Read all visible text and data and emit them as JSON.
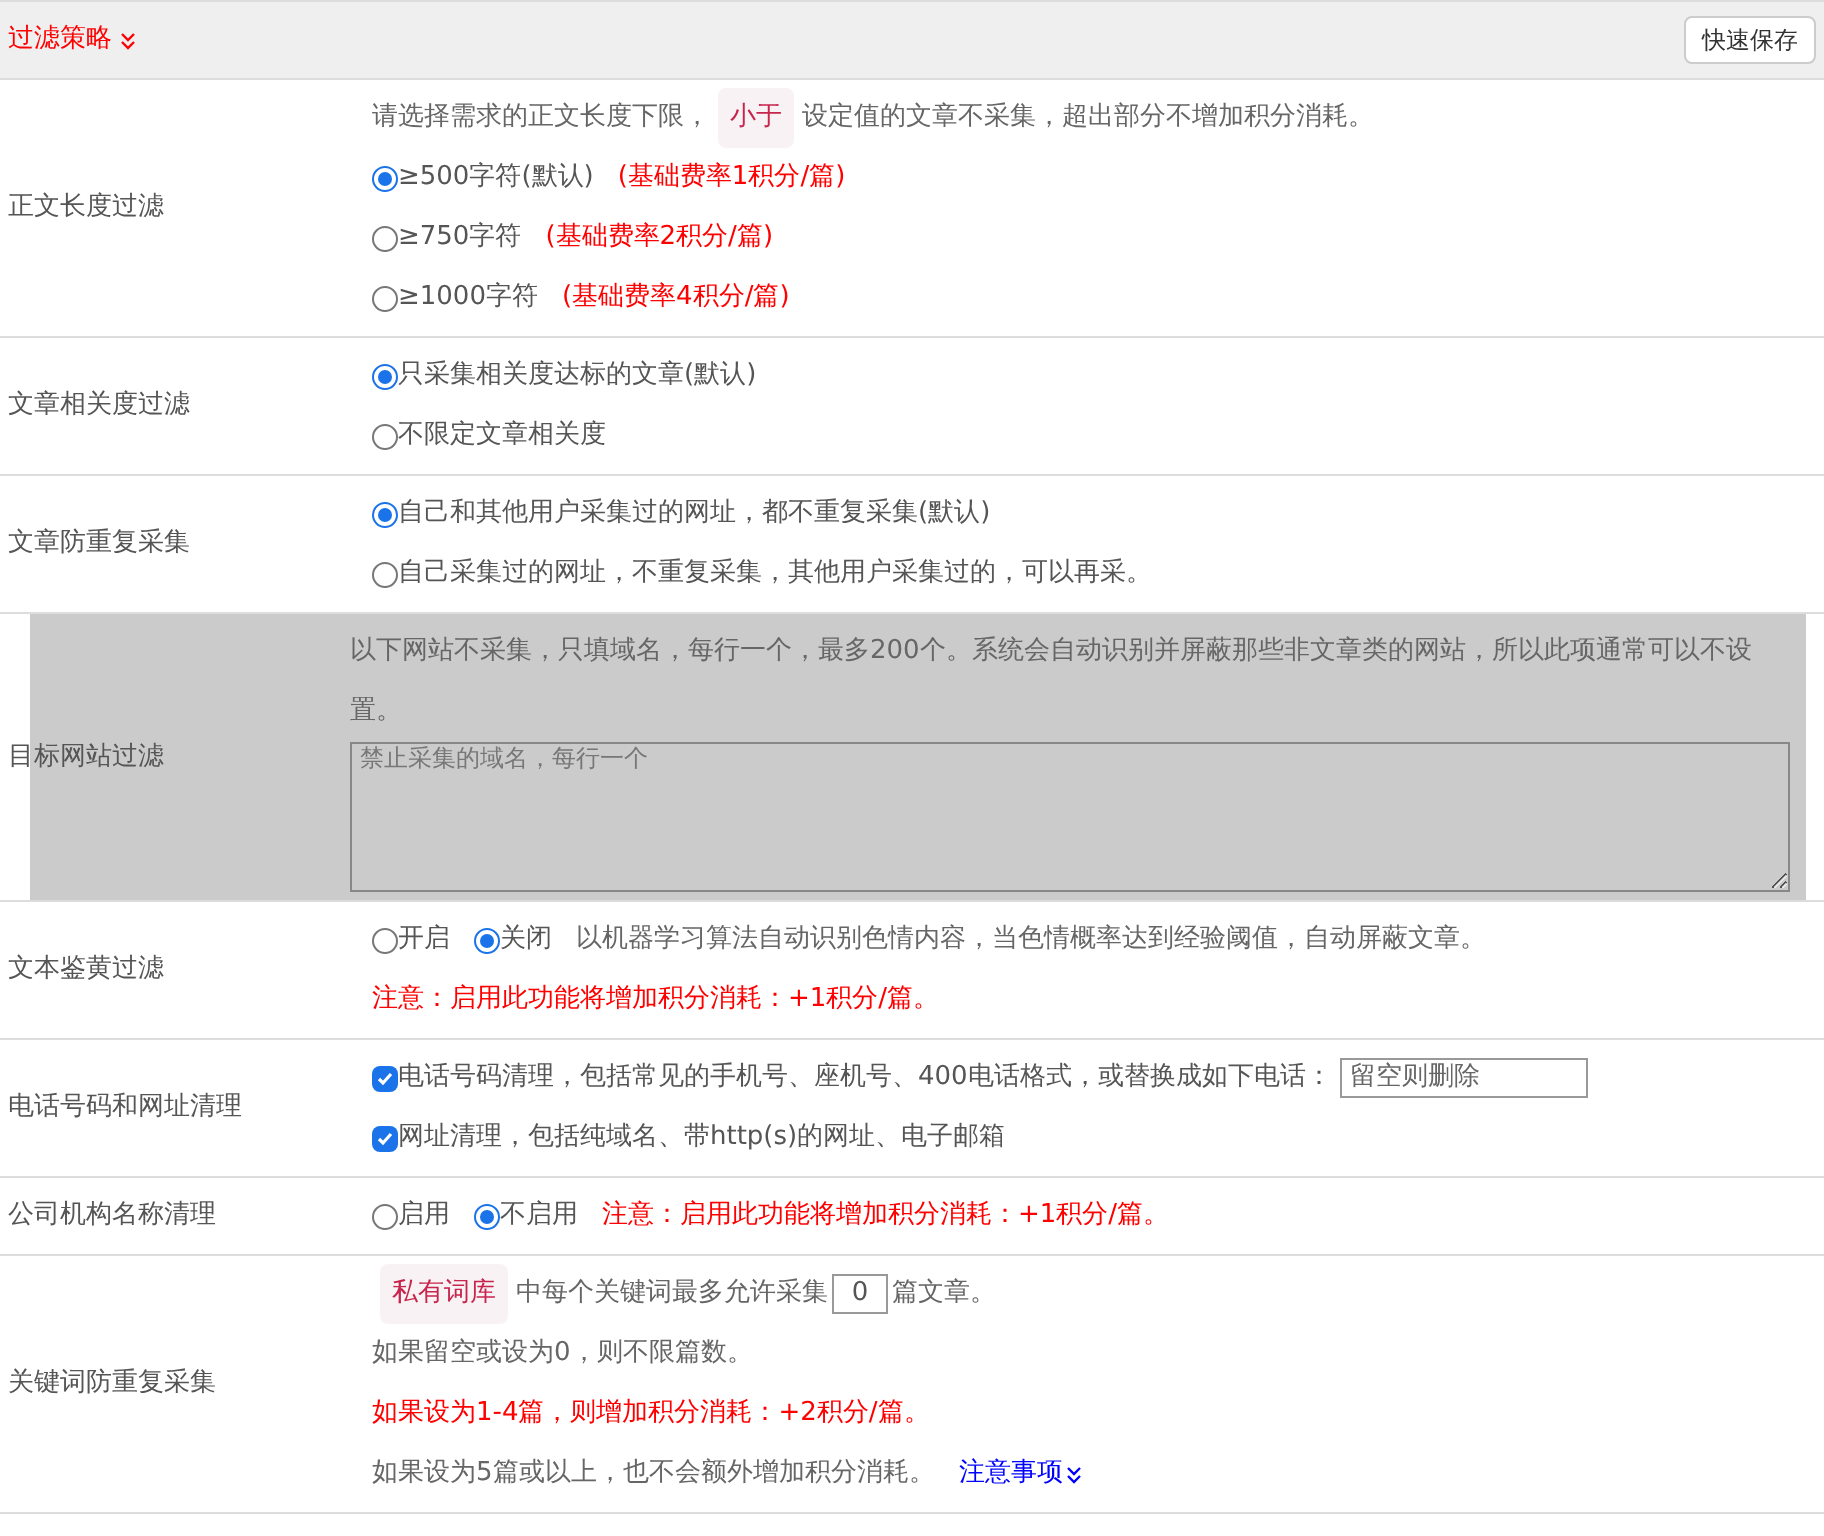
{
  "header": {
    "title": "过滤策略",
    "save_button": "快速保存"
  },
  "rows": [
    {
      "label": "正文长度过滤",
      "shaded": false,
      "lines": [
        [
          {
            "kind": "text",
            "text": "请选择需求的正文长度下限，"
          },
          {
            "kind": "tag",
            "text": "小于"
          },
          {
            "kind": "text",
            "text": "设定值的文章不采集，超出部分不增加积分消耗。"
          }
        ],
        [
          {
            "kind": "radio",
            "text": "≥500字符(默认)",
            "selected": true
          },
          {
            "kind": "note",
            "text": "(基础费率1积分/篇)"
          }
        ],
        [
          {
            "kind": "radio",
            "text": "≥750字符",
            "selected": false
          },
          {
            "kind": "note",
            "text": "(基础费率2积分/篇)"
          }
        ],
        [
          {
            "kind": "radio",
            "text": "≥1000字符",
            "selected": false
          },
          {
            "kind": "note",
            "text": "(基础费率4积分/篇)"
          }
        ]
      ]
    },
    {
      "label": "文章相关度过滤",
      "shaded": false,
      "lines": [
        [
          {
            "kind": "radio",
            "text": "只采集相关度达标的文章(默认)",
            "selected": true
          }
        ],
        [
          {
            "kind": "radio",
            "text": "不限定文章相关度",
            "selected": false
          }
        ]
      ]
    },
    {
      "label": "文章防重复采集",
      "shaded": false,
      "lines": [
        [
          {
            "kind": "radio",
            "text": "自己和其他用户采集过的网址，都不重复采集(默认)",
            "selected": true
          }
        ],
        [
          {
            "kind": "radio",
            "text": "自己采集过的网址，不重复采集，其他用户采集过的，可以再采。",
            "selected": false
          }
        ]
      ]
    },
    {
      "label": "目标网站过滤",
      "shaded": true,
      "lines": [
        [
          {
            "kind": "text",
            "text": "以下网站不采集，只填域名，每行一个，最多200个。系统会自动识别并屏蔽那些非文章类的网站，所以此项通常可以不设置。"
          }
        ],
        [
          {
            "kind": "textarea",
            "placeholder": "禁止采集的域名，每行一个"
          }
        ]
      ]
    },
    {
      "label": "文本鉴黄过滤",
      "shaded": false,
      "lines": [
        [
          {
            "kind": "radio",
            "text": "开启",
            "selected": false
          },
          {
            "kind": "radio",
            "text": "关闭",
            "selected": true
          },
          {
            "kind": "text",
            "text": "以机器学习算法自动识别色情内容，当色情概率达到经验阈值，自动屏蔽文章。"
          }
        ],
        [
          {
            "kind": "note",
            "text": "注意：启用此功能将增加积分消耗：+1积分/篇。"
          }
        ]
      ]
    },
    {
      "label": "电话号码和网址清理",
      "shaded": false,
      "lines": [
        [
          {
            "kind": "checkbox",
            "text": "电话号码清理，包括常见的手机号、座机号、400电话格式，或替换成如下电话：",
            "checked": true
          },
          {
            "kind": "input",
            "placeholder": "留空则删除"
          }
        ],
        [
          {
            "kind": "checkbox",
            "text": "网址清理，包括纯域名、带http(s)的网址、电子邮箱",
            "checked": true
          }
        ]
      ]
    },
    {
      "label": "公司机构名称清理",
      "shaded": false,
      "lines": [
        [
          {
            "kind": "radio",
            "text": "启用",
            "selected": false
          },
          {
            "kind": "radio",
            "text": "不启用",
            "selected": true
          },
          {
            "kind": "note",
            "text": "注意：启用此功能将增加积分消耗：+1积分/篇。"
          }
        ]
      ]
    },
    {
      "label": "关键词防重复采集",
      "shaded": false,
      "lines": [
        [
          {
            "kind": "tag",
            "text": "私有词库"
          },
          {
            "kind": "text",
            "text": "中每个关键词最多允许采集"
          },
          {
            "kind": "number",
            "value": "0"
          },
          {
            "kind": "text",
            "text": "篇文章。"
          }
        ],
        [
          {
            "kind": "text",
            "text": "如果留空或设为0，则不限篇数。"
          }
        ],
        [
          {
            "kind": "note",
            "text": "如果设为1-4篇，则增加积分消耗：+2积分/篇。"
          }
        ],
        [
          {
            "kind": "text",
            "text": "如果设为5篇或以上，也不会额外增加积分消耗。"
          },
          {
            "kind": "link",
            "text": "注意事项"
          }
        ]
      ]
    }
  ]
}
